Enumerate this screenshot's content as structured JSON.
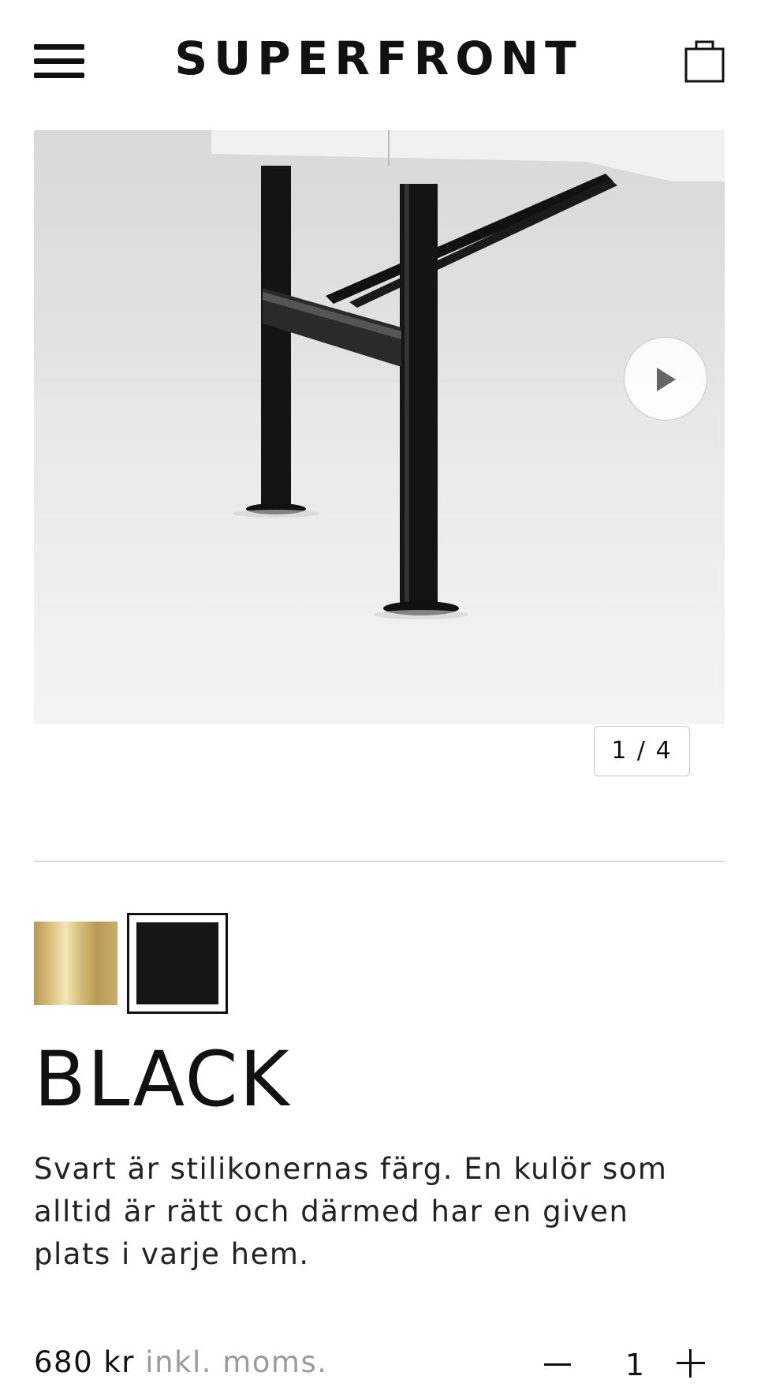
{
  "header": {
    "logo": "SUPERFRONT",
    "menu_icon": "hamburger-menu-icon",
    "cart_icon": "shopping-bag-icon"
  },
  "gallery": {
    "counter": "1 / 4",
    "current_slide": 1,
    "total_slides": 4,
    "play_icon": "play-icon"
  },
  "swatches": [
    {
      "name": "gold",
      "color": "#c9ad68",
      "selected": false
    },
    {
      "name": "black",
      "color": "#151515",
      "selected": true
    }
  ],
  "product": {
    "title": "BLACK",
    "description": "Svart är stilikonernas färg. En kulör som alltid är rätt och därmed har en given plats i varje hem.",
    "price": "680 kr",
    "vat_note": "inkl. moms."
  },
  "quantity": {
    "value": "1",
    "minus_label": "minus",
    "plus_label": "plus"
  },
  "colors": {
    "text": "#111111",
    "muted": "#9b9b9b",
    "border": "#c6c6c6"
  }
}
